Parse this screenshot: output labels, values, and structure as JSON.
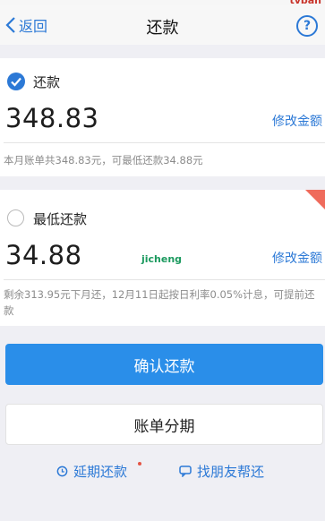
{
  "colors": {
    "accent": "#2c79d6",
    "button": "#2a8ee9",
    "ribbon": "#ef6b5c"
  },
  "watermark_top": "tvban",
  "nav": {
    "back_label": "返回",
    "title": "还款",
    "help_icon": "help-circle-icon",
    "help_text": "?"
  },
  "full_payment": {
    "selected": true,
    "label": "还款",
    "amount": "348.83",
    "modify_label": "修改金额",
    "note": "本月账单共348.83元，可最低还款34.88元"
  },
  "min_payment": {
    "selected": false,
    "label": "最低还款",
    "amount": "34.88",
    "modify_label": "修改金额",
    "note": "剩余313.95元下月还，12月11日起按日利率0.05%计息，可提前还款"
  },
  "watermark": "jicheng",
  "actions": {
    "confirm_label": "确认还款",
    "installment_label": "账单分期"
  },
  "links": {
    "defer_label": "延期还款",
    "friend_label": "找朋友帮还"
  }
}
